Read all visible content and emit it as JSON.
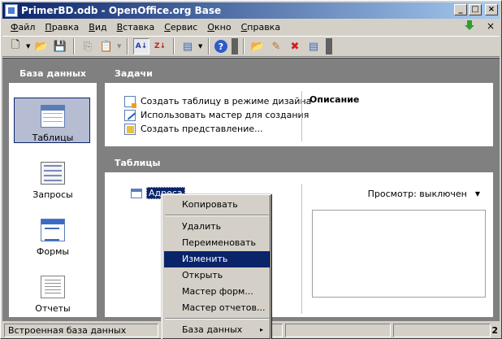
{
  "window": {
    "title": "PrimerBD.odb - OpenOffice.org Base",
    "buttons": [
      "_",
      "□",
      "×"
    ]
  },
  "menubar": {
    "items": [
      {
        "underline": "Ф",
        "rest": "айл"
      },
      {
        "underline": "П",
        "rest": "равка"
      },
      {
        "underline": "В",
        "rest": "ид"
      },
      {
        "underline": "В",
        "rest": "ставка"
      },
      {
        "underline": "С",
        "rest": "ервис"
      },
      {
        "underline": "О",
        "rest": "кно"
      },
      {
        "underline": "С",
        "rest": "правка"
      }
    ],
    "close_glyph": "×"
  },
  "toolbar": {
    "icons": [
      "new-document-icon",
      "open-folder-icon",
      "save-icon",
      "copy-icon",
      "paste-icon",
      "sort-ascending-icon",
      "sort-descending-icon",
      "insert-object-icon",
      "help-icon",
      "open-db-object-icon",
      "edit-icon",
      "delete-icon",
      "rename-icon"
    ],
    "glyphs": {
      "new": "🗋",
      "open": "📂",
      "save": "💾",
      "copy": "⎘",
      "paste": "📋",
      "sort_asc": "A↓",
      "sort_desc": "Z↓",
      "insert": "▤",
      "help": "?",
      "open_obj": "📂",
      "edit": "✎",
      "delete": "✖",
      "rename": "▤"
    }
  },
  "sidebar": {
    "header": "База данных",
    "items": [
      {
        "label": "Таблицы",
        "icon": "tables-icon",
        "selected": true
      },
      {
        "label": "Запросы",
        "icon": "queries-icon",
        "selected": false
      },
      {
        "label": "Формы",
        "icon": "forms-icon",
        "selected": false
      },
      {
        "label": "Отчеты",
        "icon": "reports-icon",
        "selected": false
      }
    ]
  },
  "tasks": {
    "header": "Задачи",
    "items": [
      "Создать таблицу в режиме дизайна",
      "Использовать мастер для создания",
      "Создать представление..."
    ],
    "description_title": "Описание"
  },
  "tables": {
    "header": "Таблицы",
    "entry": "Адреса",
    "preview_label": "Просмотр: выключен",
    "preview_arrow": "▼"
  },
  "context_menu": {
    "items": [
      {
        "label": "Копировать",
        "highlighted": false
      },
      {
        "label": "Удалить",
        "highlighted": false
      },
      {
        "label": "Переименовать",
        "highlighted": false
      },
      {
        "label": "Изменить",
        "highlighted": true
      },
      {
        "label": "Открыть",
        "highlighted": false
      },
      {
        "label": "Мастер форм...",
        "highlighted": false
      },
      {
        "label": "Мастер отчетов...",
        "highlighted": false
      },
      {
        "label": "База данных",
        "highlighted": false,
        "submenu_arrow": "▸"
      }
    ]
  },
  "statusbar": {
    "text": "Встроенная база данных",
    "grip": "2"
  },
  "colors": {
    "title_active": "#0a246a",
    "panel_header": "#808080",
    "selection": "#0a246a"
  }
}
